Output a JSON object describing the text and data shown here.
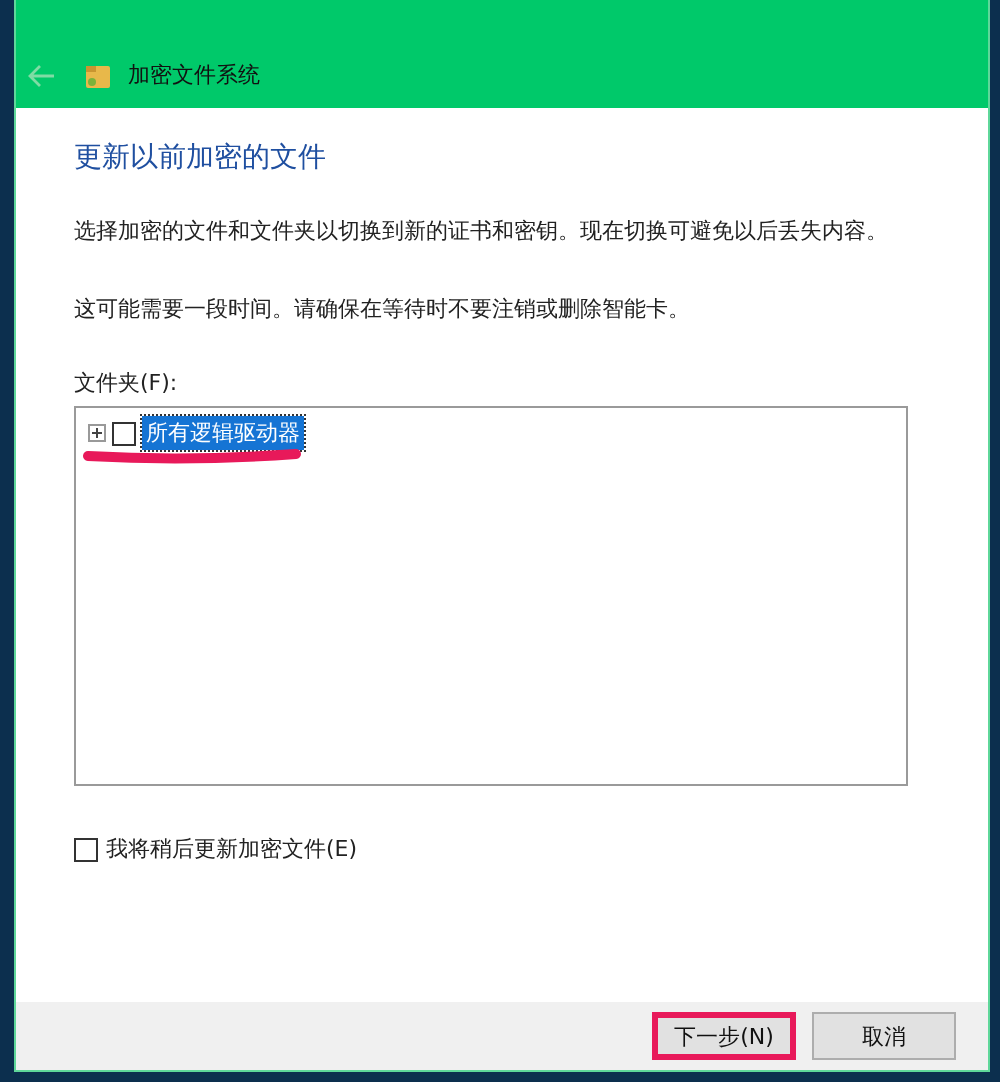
{
  "window": {
    "title": "加密文件系统"
  },
  "heading": "更新以前加密的文件",
  "paragraphs": [
    "选择加密的文件和文件夹以切换到新的证书和密钥。现在切换可避免以后丢失内容。",
    "这可能需要一段时间。请确保在等待时不要注销或删除智能卡。"
  ],
  "folder_tree": {
    "label": "文件夹(F):",
    "items": [
      {
        "label": "所有逻辑驱动器",
        "expanded": false,
        "checked": false,
        "selected": true,
        "underlined": true
      }
    ]
  },
  "later_checkbox": {
    "label": "我将稍后更新加密文件(E)",
    "checked": false
  },
  "buttons": [
    {
      "label": "下一步(N)",
      "highlighted": true
    },
    {
      "label": "取消",
      "highlighted": false
    }
  ]
}
